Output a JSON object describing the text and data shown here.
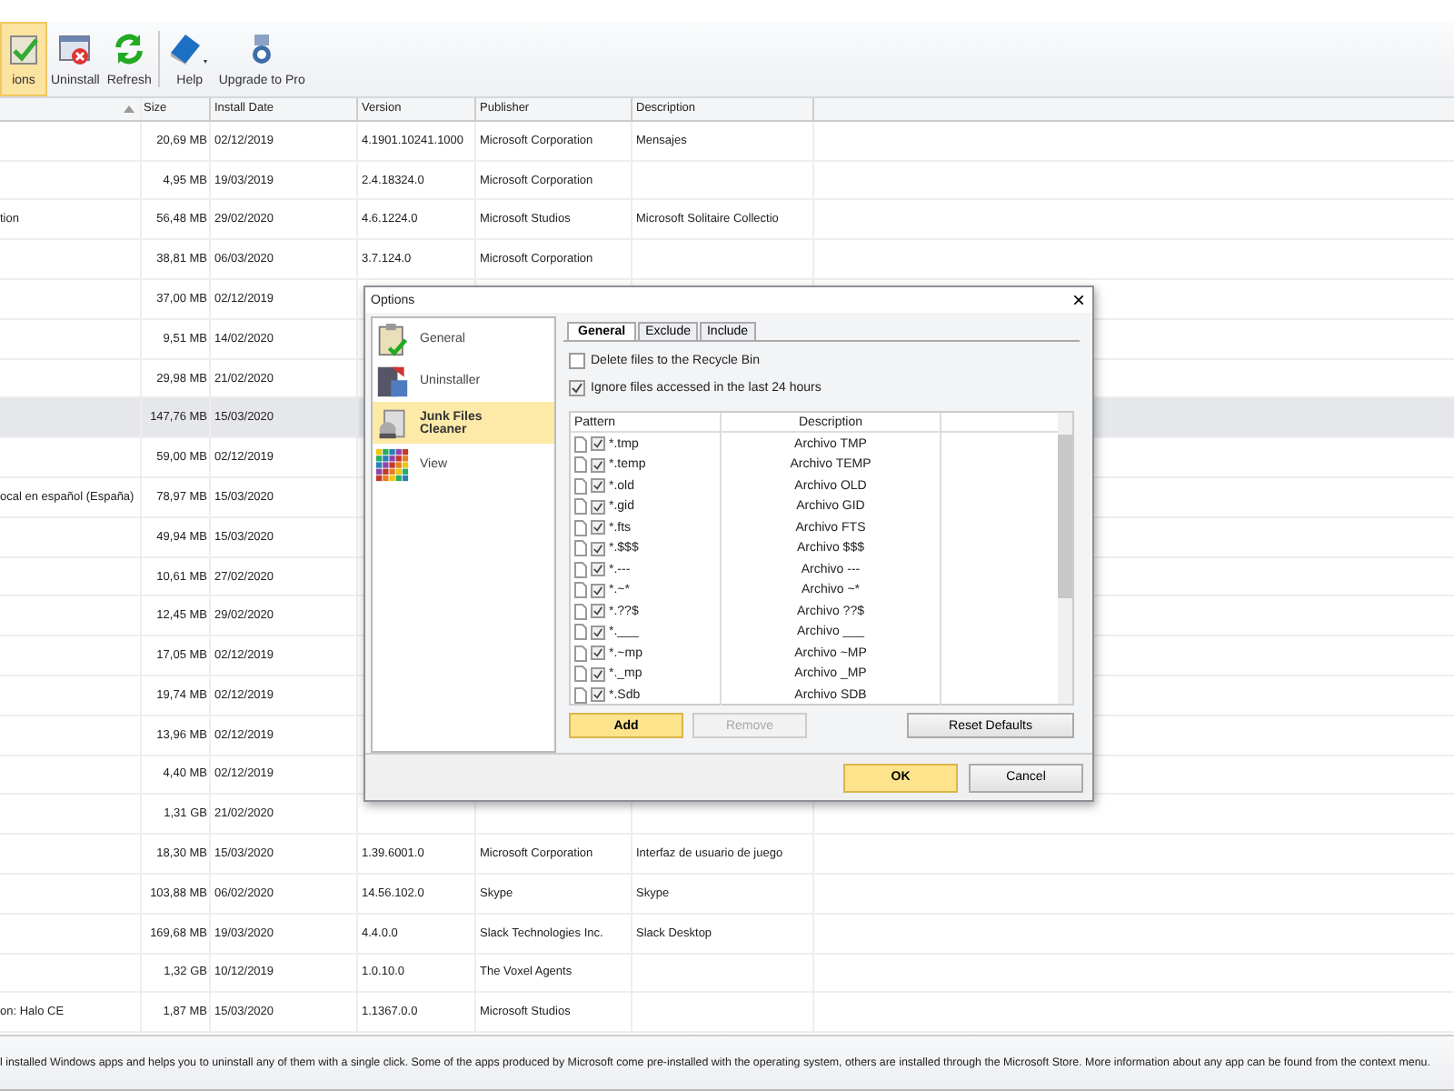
{
  "toolbar": [
    {
      "label": "ions",
      "kind": "options",
      "selected": true
    },
    {
      "label": "Uninstall",
      "kind": "uninstall",
      "selected": false
    },
    {
      "label": "Refresh",
      "kind": "refresh",
      "selected": false
    },
    {
      "label": "Help",
      "kind": "help",
      "selected": false
    },
    {
      "label": "Upgrade to Pro",
      "kind": "upgrade",
      "selected": false
    }
  ],
  "table": {
    "columns": [
      "Size",
      "Install Date",
      "Version",
      "Publisher",
      "Description"
    ],
    "rows": [
      {
        "name": "",
        "size": "20,69 MB",
        "date": "02/12/2019",
        "version": "4.1901.10241.1000",
        "publisher": "Microsoft Corporation",
        "description": "Mensajes",
        "selected": false
      },
      {
        "name": "",
        "size": "4,95 MB",
        "date": "19/03/2019",
        "version": "2.4.18324.0",
        "publisher": "Microsoft Corporation",
        "description": "",
        "selected": false
      },
      {
        "name": "tion",
        "size": "56,48 MB",
        "date": "29/02/2020",
        "version": "4.6.1224.0",
        "publisher": "Microsoft Studios",
        "description": "Microsoft Solitaire Collectio",
        "selected": false
      },
      {
        "name": "",
        "size": "38,81 MB",
        "date": "06/03/2020",
        "version": "3.7.124.0",
        "publisher": "Microsoft Corporation",
        "description": "",
        "selected": false
      },
      {
        "name": "",
        "size": "37,00 MB",
        "date": "02/12/2019",
        "version": "",
        "publisher": "",
        "description": "",
        "selected": false
      },
      {
        "name": "",
        "size": "9,51 MB",
        "date": "14/02/2020",
        "version": "",
        "publisher": "",
        "description": "",
        "selected": false
      },
      {
        "name": "",
        "size": "29,98 MB",
        "date": "21/02/2020",
        "version": "",
        "publisher": "",
        "description": "",
        "selected": false
      },
      {
        "name": "",
        "size": "147,76 MB",
        "date": "15/03/2020",
        "version": "",
        "publisher": "",
        "description": "",
        "selected": true
      },
      {
        "name": "",
        "size": "59,00 MB",
        "date": "02/12/2019",
        "version": "",
        "publisher": "",
        "description": "",
        "selected": false
      },
      {
        "name": "ocal en español (España)",
        "size": "78,97 MB",
        "date": "15/03/2020",
        "version": "",
        "publisher": "",
        "description": "",
        "selected": false
      },
      {
        "name": "",
        "size": "49,94 MB",
        "date": "15/03/2020",
        "version": "",
        "publisher": "",
        "description": "",
        "selected": false
      },
      {
        "name": "",
        "size": "10,61 MB",
        "date": "27/02/2020",
        "version": "",
        "publisher": "",
        "description": "",
        "selected": false
      },
      {
        "name": "",
        "size": "12,45 MB",
        "date": "29/02/2020",
        "version": "",
        "publisher": "",
        "description": "",
        "selected": false
      },
      {
        "name": "",
        "size": "17,05 MB",
        "date": "02/12/2019",
        "version": "",
        "publisher": "",
        "description": "",
        "selected": false
      },
      {
        "name": "",
        "size": "19,74 MB",
        "date": "02/12/2019",
        "version": "",
        "publisher": "",
        "description": "",
        "selected": false
      },
      {
        "name": "",
        "size": "13,96 MB",
        "date": "02/12/2019",
        "version": "",
        "publisher": "",
        "description": "",
        "selected": false
      },
      {
        "name": "",
        "size": "4,40 MB",
        "date": "02/12/2019",
        "version": "",
        "publisher": "",
        "description": "",
        "selected": false
      },
      {
        "name": "",
        "size": "1,31 GB",
        "date": "21/02/2020",
        "version": "",
        "publisher": "",
        "description": "",
        "selected": false
      },
      {
        "name": "",
        "size": "18,30 MB",
        "date": "15/03/2020",
        "version": "1.39.6001.0",
        "publisher": "Microsoft Corporation",
        "description": "Interfaz de usuario de juego",
        "selected": false
      },
      {
        "name": "",
        "size": "103,88 MB",
        "date": "06/02/2020",
        "version": "14.56.102.0",
        "publisher": "Skype",
        "description": "Skype",
        "selected": false
      },
      {
        "name": "",
        "size": "169,68 MB",
        "date": "19/03/2020",
        "version": "4.4.0.0",
        "publisher": "Slack Technologies Inc.",
        "description": "Slack Desktop",
        "selected": false
      },
      {
        "name": "",
        "size": "1,32 GB",
        "date": "10/12/2019",
        "version": "1.0.10.0",
        "publisher": "The Voxel Agents",
        "description": "",
        "selected": false
      },
      {
        "name": "on: Halo CE",
        "size": "1,87 MB",
        "date": "15/03/2020",
        "version": "1.1367.0.0",
        "publisher": "Microsoft Studios",
        "description": "",
        "selected": false
      }
    ]
  },
  "status_bar": "l installed Windows apps and helps you to uninstall any of them with a single click. Some of the apps produced by Microsoft  come pre-installed with the operating system, others are installed through the Microsoft Store. More information about any app can be found from the context menu.",
  "dialog": {
    "title": "Options",
    "close": "×",
    "sidebar": [
      {
        "label": "General",
        "kind": "general",
        "selected": false
      },
      {
        "label": "Uninstaller",
        "kind": "uninstaller",
        "selected": false
      },
      {
        "label": "Junk Files Cleaner",
        "kind": "junk",
        "selected": true
      },
      {
        "label": "View",
        "kind": "view",
        "selected": false
      }
    ],
    "tabs": [
      {
        "label": "General",
        "selected": true
      },
      {
        "label": "Exclude",
        "selected": false
      },
      {
        "label": "Include",
        "selected": false
      }
    ],
    "options": [
      {
        "label": "Delete files to the Recycle Bin",
        "checked": false
      },
      {
        "label": "Ignore files accessed in the last 24 hours",
        "checked": true
      }
    ],
    "columns": [
      "Pattern",
      "Description"
    ],
    "patterns": [
      {
        "pattern": "*.tmp",
        "description": "Archivo TMP",
        "checked": true
      },
      {
        "pattern": "*.temp",
        "description": "Archivo TEMP",
        "checked": true
      },
      {
        "pattern": "*.old",
        "description": "Archivo OLD",
        "checked": true
      },
      {
        "pattern": "*.gid",
        "description": "Archivo GID",
        "checked": true
      },
      {
        "pattern": "*.fts",
        "description": "Archivo FTS",
        "checked": true
      },
      {
        "pattern": "*.$$$",
        "description": "Archivo $$$",
        "checked": true
      },
      {
        "pattern": "*.---",
        "description": "Archivo ---",
        "checked": true
      },
      {
        "pattern": "*.~*",
        "description": "Archivo ~*",
        "checked": true
      },
      {
        "pattern": "*.??$",
        "description": "Archivo ??$",
        "checked": true
      },
      {
        "pattern": "*.___",
        "description": "Archivo ___",
        "checked": true
      },
      {
        "pattern": "*.~mp",
        "description": "Archivo ~MP",
        "checked": true
      },
      {
        "pattern": "*._mp",
        "description": "Archivo _MP",
        "checked": true
      },
      {
        "pattern": "*.Sdb",
        "description": "Archivo SDB",
        "checked": true
      }
    ],
    "list_buttons": [
      {
        "label": "Add",
        "kind": "primary",
        "disabled": false
      },
      {
        "label": "Remove",
        "kind": "normal",
        "disabled": true
      },
      {
        "label": "Reset Defaults",
        "kind": "right",
        "disabled": false
      }
    ],
    "buttons": [
      {
        "label": "OK",
        "kind": "primary"
      },
      {
        "label": "Cancel",
        "kind": "normal"
      }
    ]
  }
}
